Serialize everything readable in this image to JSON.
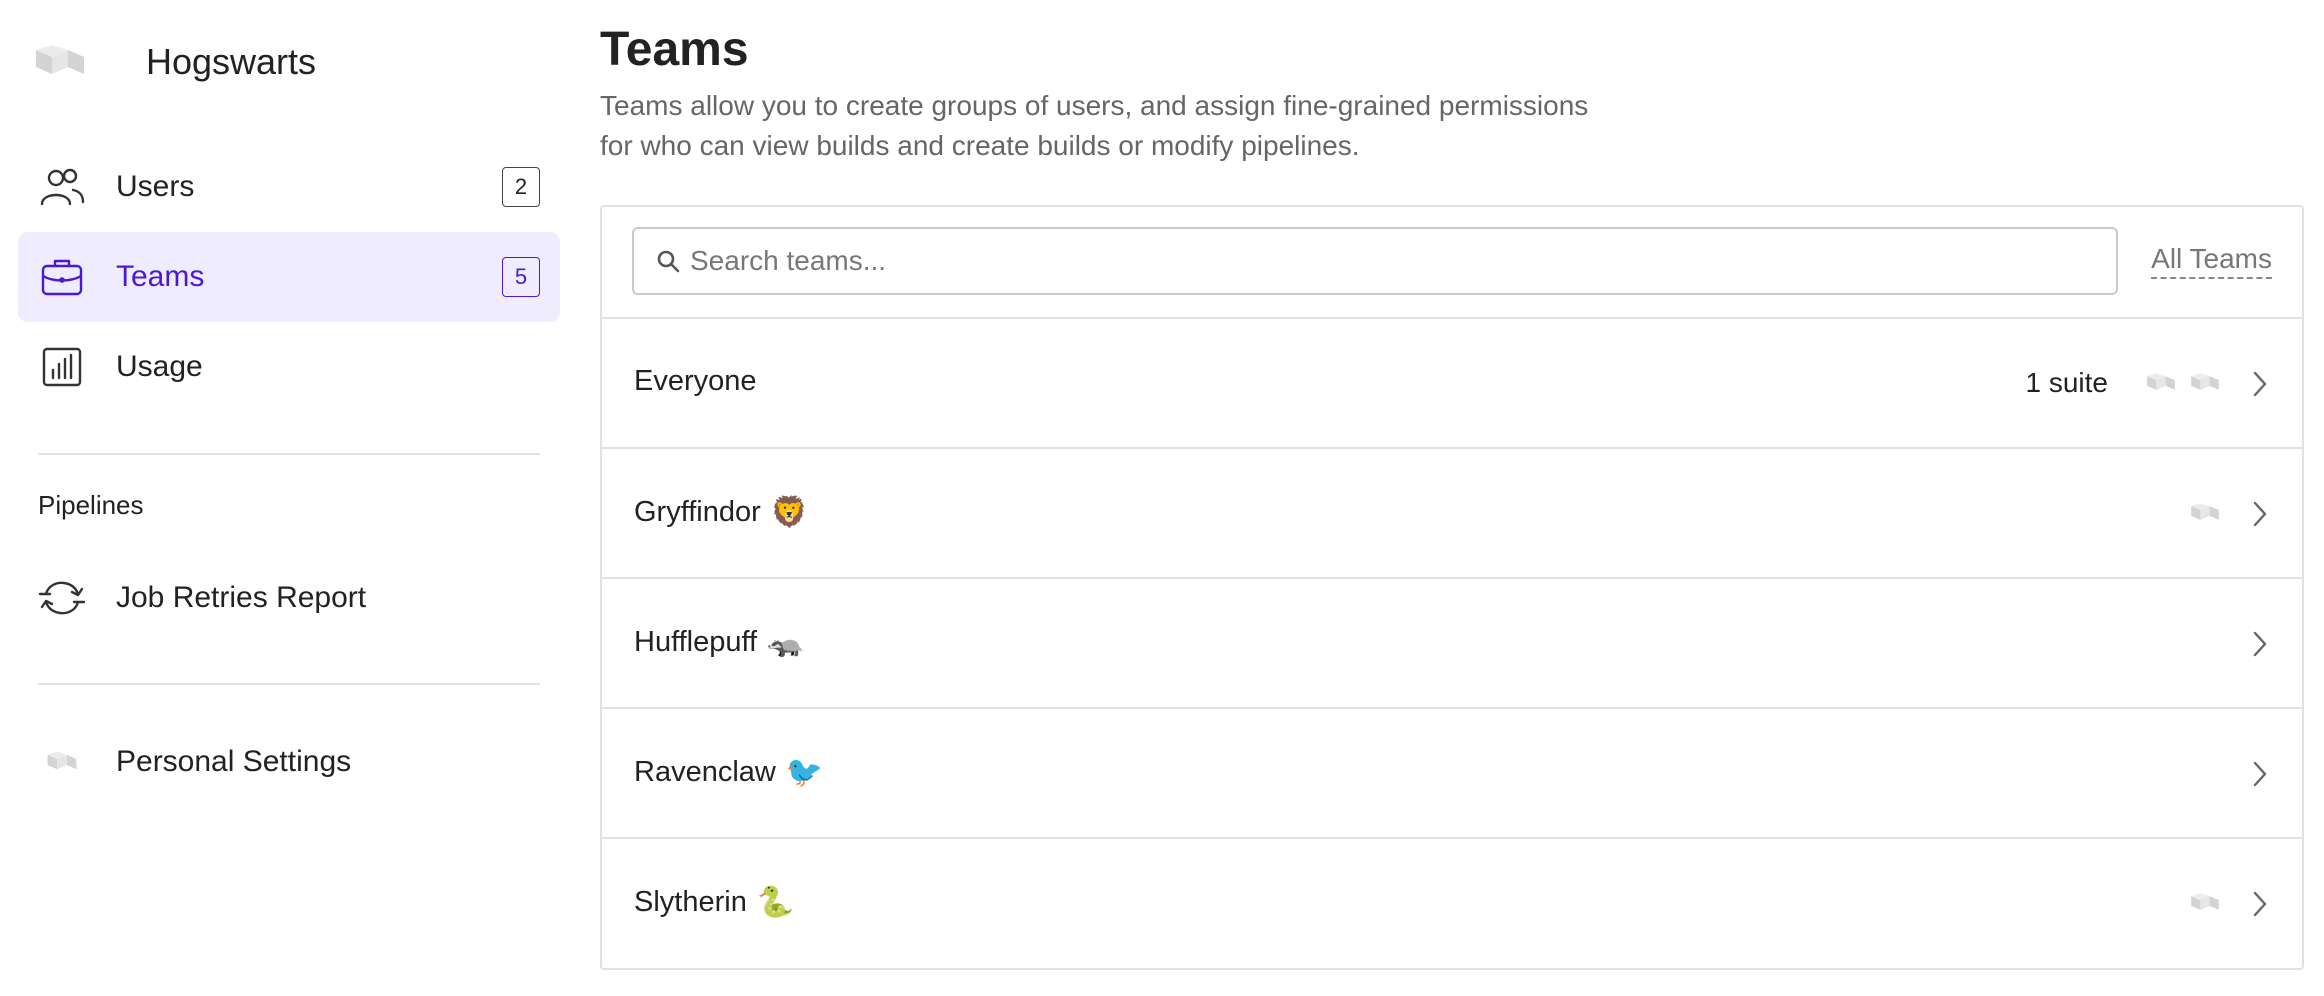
{
  "org": {
    "name": "Hogswarts"
  },
  "sidebar": {
    "items": [
      {
        "key": "users",
        "label": "Users",
        "count": "2",
        "icon": "users-icon",
        "active": false
      },
      {
        "key": "teams",
        "label": "Teams",
        "count": "5",
        "icon": "briefcase-icon",
        "active": true
      },
      {
        "key": "usage",
        "label": "Usage",
        "icon": "bar-chart-icon",
        "active": false
      }
    ],
    "pipelines_title": "Pipelines",
    "pipelines_items": [
      {
        "label": "Job Retries Report",
        "icon": "retry-icon"
      }
    ],
    "personal_settings_label": "Personal Settings"
  },
  "main": {
    "title": "Teams",
    "description": "Teams allow you to create groups of users, and assign fine-grained permissions for who can view builds and create builds or modify pipelines.",
    "search": {
      "placeholder": "Search teams...",
      "value": ""
    },
    "filter_label": "All Teams",
    "teams": [
      {
        "name": "Everyone",
        "emoji": "",
        "meta": "1 suite",
        "avatars": 2
      },
      {
        "name": "Gryffindor",
        "emoji": "🦁",
        "meta": "",
        "avatars": 1
      },
      {
        "name": "Hufflepuff",
        "emoji": "🦡",
        "meta": "",
        "avatars": 0
      },
      {
        "name": "Ravenclaw",
        "emoji": "🐦",
        "meta": "",
        "avatars": 0
      },
      {
        "name": "Slytherin",
        "emoji": "🐍",
        "meta": "",
        "avatars": 1
      }
    ]
  },
  "colors": {
    "accent": "#4b19d5",
    "active_bg": "#efecfd",
    "border": "#e1e1e1",
    "muted_text": "#666666",
    "logo_gray": "#c8c8c8"
  }
}
